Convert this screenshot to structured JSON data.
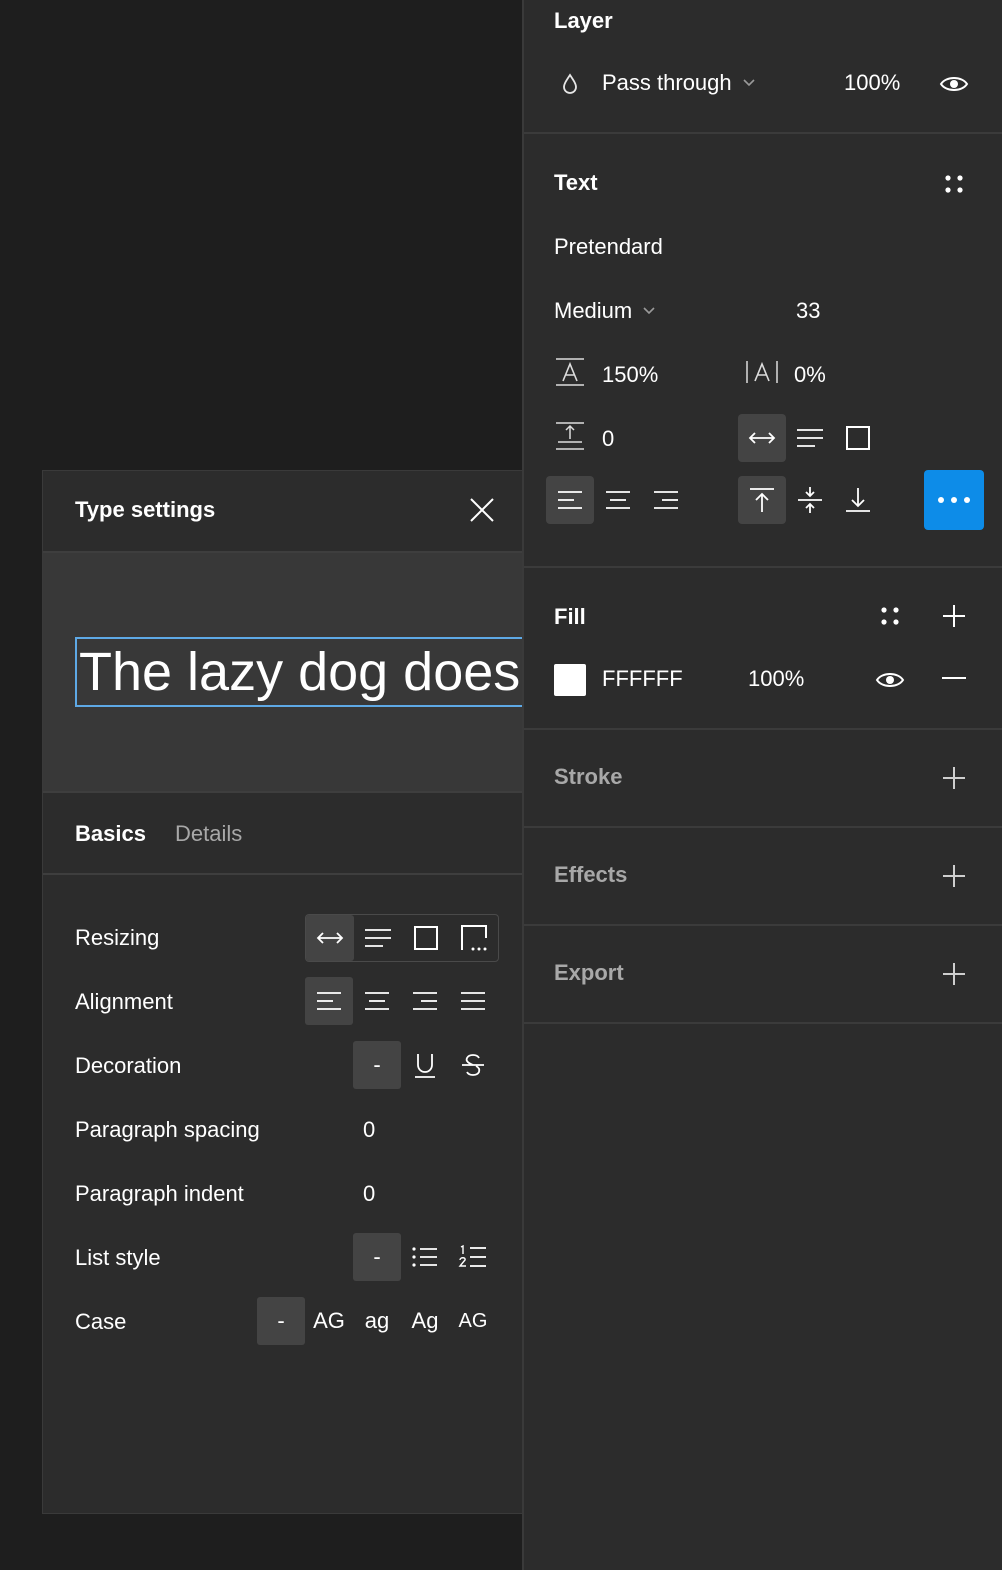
{
  "layer": {
    "title": "Layer",
    "blend_mode": "Pass through",
    "opacity": "100%"
  },
  "text": {
    "title": "Text",
    "font_family": "Pretendard",
    "font_weight": "Medium",
    "font_size": "33",
    "line_height": "150%",
    "letter_spacing": "0%",
    "paragraph_spacing": "0"
  },
  "fill": {
    "title": "Fill",
    "hex": "FFFFFF",
    "opacity": "100%",
    "swatch_color": "#FFFFFF"
  },
  "stroke": {
    "title": "Stroke"
  },
  "effects": {
    "title": "Effects"
  },
  "export": {
    "title": "Export"
  },
  "type_settings": {
    "title": "Type settings",
    "preview_text": "The lazy dog doesn't jump",
    "tabs": {
      "basics": "Basics",
      "details": "Details"
    },
    "rows": {
      "resizing": "Resizing",
      "alignment": "Alignment",
      "decoration": "Decoration",
      "paragraph_spacing": "Paragraph spacing",
      "paragraph_indent": "Paragraph indent",
      "list_style": "List style",
      "case": "Case"
    },
    "values": {
      "paragraph_spacing": "0",
      "paragraph_indent": "0"
    },
    "decoration_none": "-",
    "list_none": "-",
    "case_options": {
      "none": "-",
      "upper": "AG",
      "lower": "ag",
      "title": "Ag",
      "small_caps": "AG"
    }
  },
  "colors": {
    "accent": "#0d8ce8",
    "panel_bg": "#2c2c2c",
    "canvas_bg": "#1e1e1e",
    "preview_outline": "#5ea9e6"
  }
}
